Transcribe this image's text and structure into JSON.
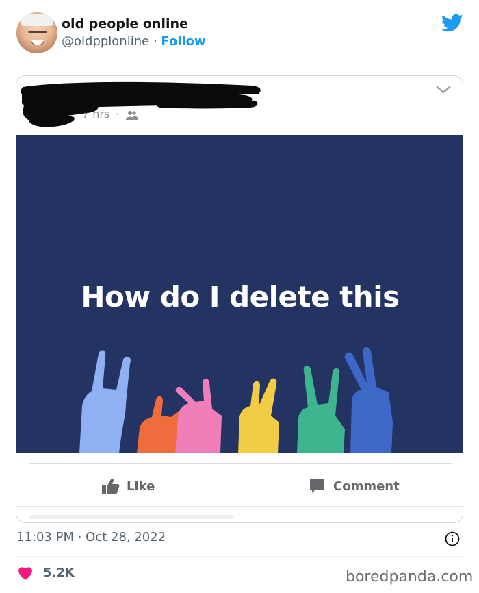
{
  "tweet": {
    "author_name": "old people online",
    "author_handle": "@oldpplonline",
    "separator": "·",
    "follow_label": "Follow",
    "timestamp": "11:03 PM · Oct 28, 2022",
    "likes_count": "5.2K"
  },
  "embedded_post": {
    "time_ago": "7 hrs",
    "separator": "·",
    "post_text": "How do I delete this",
    "background_color": "#243462",
    "like_label": "Like",
    "comment_label": "Comment"
  },
  "watermark": "boredpanda.com",
  "icons": {
    "brand": "twitter-bird-icon",
    "more": "chevron-down-icon",
    "audience": "friends-icon",
    "like": "thumbs-up-icon",
    "comment": "comment-icon",
    "info": "info-icon",
    "heart": "heart-icon"
  },
  "colors": {
    "accent": "#1d9bf0",
    "heart": "#f91880",
    "post_bg": "#243462"
  }
}
